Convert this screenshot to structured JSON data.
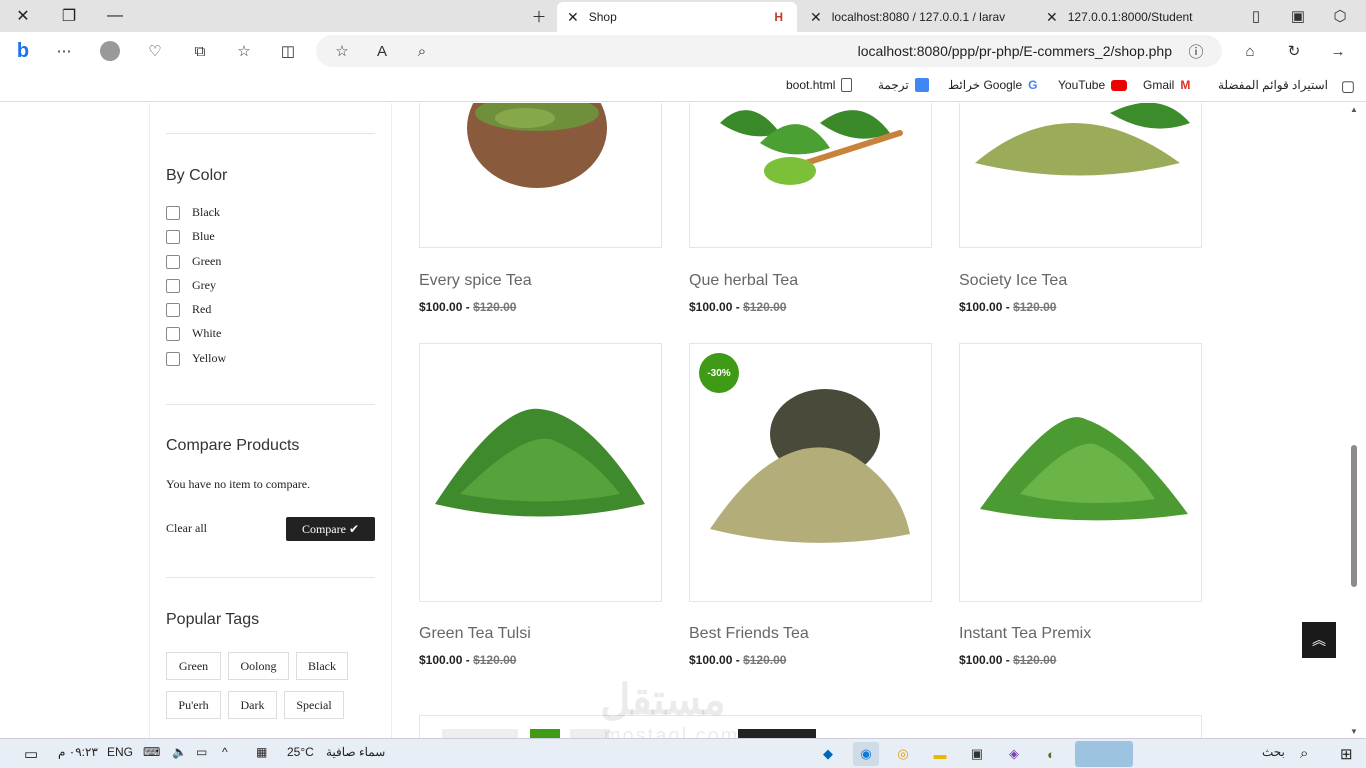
{
  "browser": {
    "tabs": [
      {
        "label": "Shop"
      },
      {
        "label": "localhost:8080 / 127.0.0.1 / larav"
      },
      {
        "label": "127.0.0.1:8000/Student"
      }
    ],
    "url": "localhost:8080/ppp/pr-php/E-commers_2/shop.php",
    "bookmarks": [
      {
        "label": "استيراد قوائم المفضلة"
      },
      {
        "label": "Gmail"
      },
      {
        "label": "YouTube"
      },
      {
        "label": "خرائط Google"
      },
      {
        "label": "ترجمة"
      },
      {
        "label": "boot.html"
      }
    ]
  },
  "sidebar": {
    "color_title": "By Color",
    "colors": [
      "Black",
      "Blue",
      "Green",
      "Grey",
      "Red",
      "White",
      "Yellow"
    ],
    "compare_title": "Compare Products",
    "compare_empty": "You have no item to compare.",
    "clear_all": "Clear all",
    "compare_button": "Compare ✔",
    "tags_title": "Popular Tags",
    "tags": [
      "Green",
      "Oolong",
      "Black",
      "Pu'erh",
      "Dark",
      "Special"
    ]
  },
  "products": [
    {
      "name": "Every spice Tea",
      "price": "$100.00",
      "old_price": "$120.00"
    },
    {
      "name": "Que herbal Tea",
      "price": "$100.00",
      "old_price": "$120.00"
    },
    {
      "name": "Society Ice Tea",
      "price": "$100.00",
      "old_price": "$120.00"
    },
    {
      "name": "Green Tea Tulsi",
      "price": "$100.00",
      "old_price": "$120.00"
    },
    {
      "name": "Best Friends Tea",
      "price": "$100.00",
      "old_price": "$120.00",
      "badge": "-30%"
    },
    {
      "name": "Instant Tea Premix",
      "price": "$100.00",
      "old_price": "$120.00"
    }
  ],
  "taskbar": {
    "search": "بحث",
    "weather_temp": "25°C",
    "weather_text": "سماء صافية",
    "lang": "ENG",
    "time": "٠٩:٢٣ م"
  },
  "watermark": {
    "text": "مستقل",
    "sub": "mostaql.com"
  },
  "colors": {
    "accent_green": "#3f9a16",
    "dark_button": "#222222"
  }
}
